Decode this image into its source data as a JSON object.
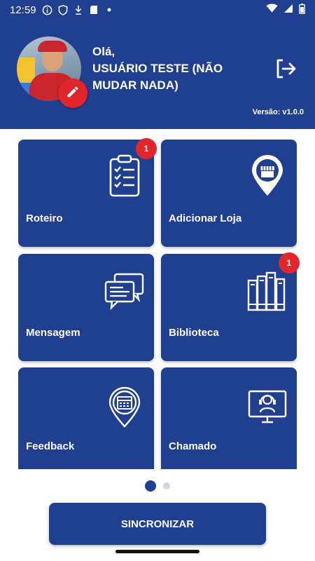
{
  "status": {
    "time": "12:59",
    "icons_left": [
      "info-icon",
      "shield-icon",
      "download-icon",
      "sd-card-icon",
      "dot-icon"
    ],
    "icons_right": [
      "wifi-icon",
      "signal-icon",
      "battery-icon"
    ]
  },
  "header": {
    "greeting": "Olá,",
    "user_name": "USUÁRIO TESTE (NÃO MUDAR NADA)",
    "version": "Versão: v1.0.0"
  },
  "cards": [
    {
      "label": "Roteiro",
      "icon": "clipboard-checklist-icon",
      "badge": "1"
    },
    {
      "label": "Adicionar Loja",
      "icon": "store-pin-icon",
      "badge": ""
    },
    {
      "label": "Mensagem",
      "icon": "chat-bubbles-icon",
      "badge": ""
    },
    {
      "label": "Biblioteca",
      "icon": "books-icon",
      "badge": "1"
    },
    {
      "label": "Feedback",
      "icon": "calendar-pin-icon",
      "badge": ""
    },
    {
      "label": "Chamado",
      "icon": "support-headset-icon",
      "badge": ""
    }
  ],
  "pager": {
    "pages": 2,
    "current": 1
  },
  "sync_label": "SINCRONIZAR",
  "colors": {
    "primary": "#213f8f",
    "accent": "#e0262a"
  }
}
